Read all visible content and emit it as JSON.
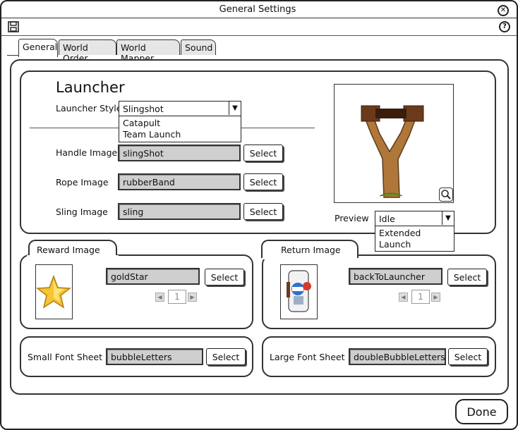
{
  "window": {
    "title": "General Settings"
  },
  "tabs": [
    {
      "label": "General",
      "active": true
    },
    {
      "label": "World Order",
      "active": false
    },
    {
      "label": "World Mapper",
      "active": false
    },
    {
      "label": "Sound",
      "active": false
    }
  ],
  "launcher": {
    "heading": "Launcher",
    "style_label": "Launcher Style",
    "style_value": "Slingshot",
    "style_options": [
      "Catapult",
      "Team Launch"
    ],
    "handle": {
      "label": "Handle Image",
      "value": "slingShot",
      "button": "Select"
    },
    "rope": {
      "label": "Rope Image",
      "value": "rubberBand",
      "button": "Select"
    },
    "sling": {
      "label": "Sling Image",
      "value": "sling",
      "button": "Select"
    },
    "preview_label": "Preview",
    "preview_value": "Idle",
    "preview_options": [
      "Extended",
      "Launch"
    ]
  },
  "reward": {
    "tab_label": "Reward Image",
    "value": "goldStar",
    "button": "Select",
    "page": "1"
  },
  "return_image": {
    "tab_label": "Return Image",
    "value": "backToLauncher",
    "button": "Select",
    "page": "1"
  },
  "small_font": {
    "label": "Small Font Sheet",
    "value": "bubbleLetters",
    "button": "Select"
  },
  "large_font": {
    "label": "Large Font Sheet",
    "value": "doubleBubbleLetters",
    "button": "Select"
  },
  "footer": {
    "done_label": "Done"
  }
}
